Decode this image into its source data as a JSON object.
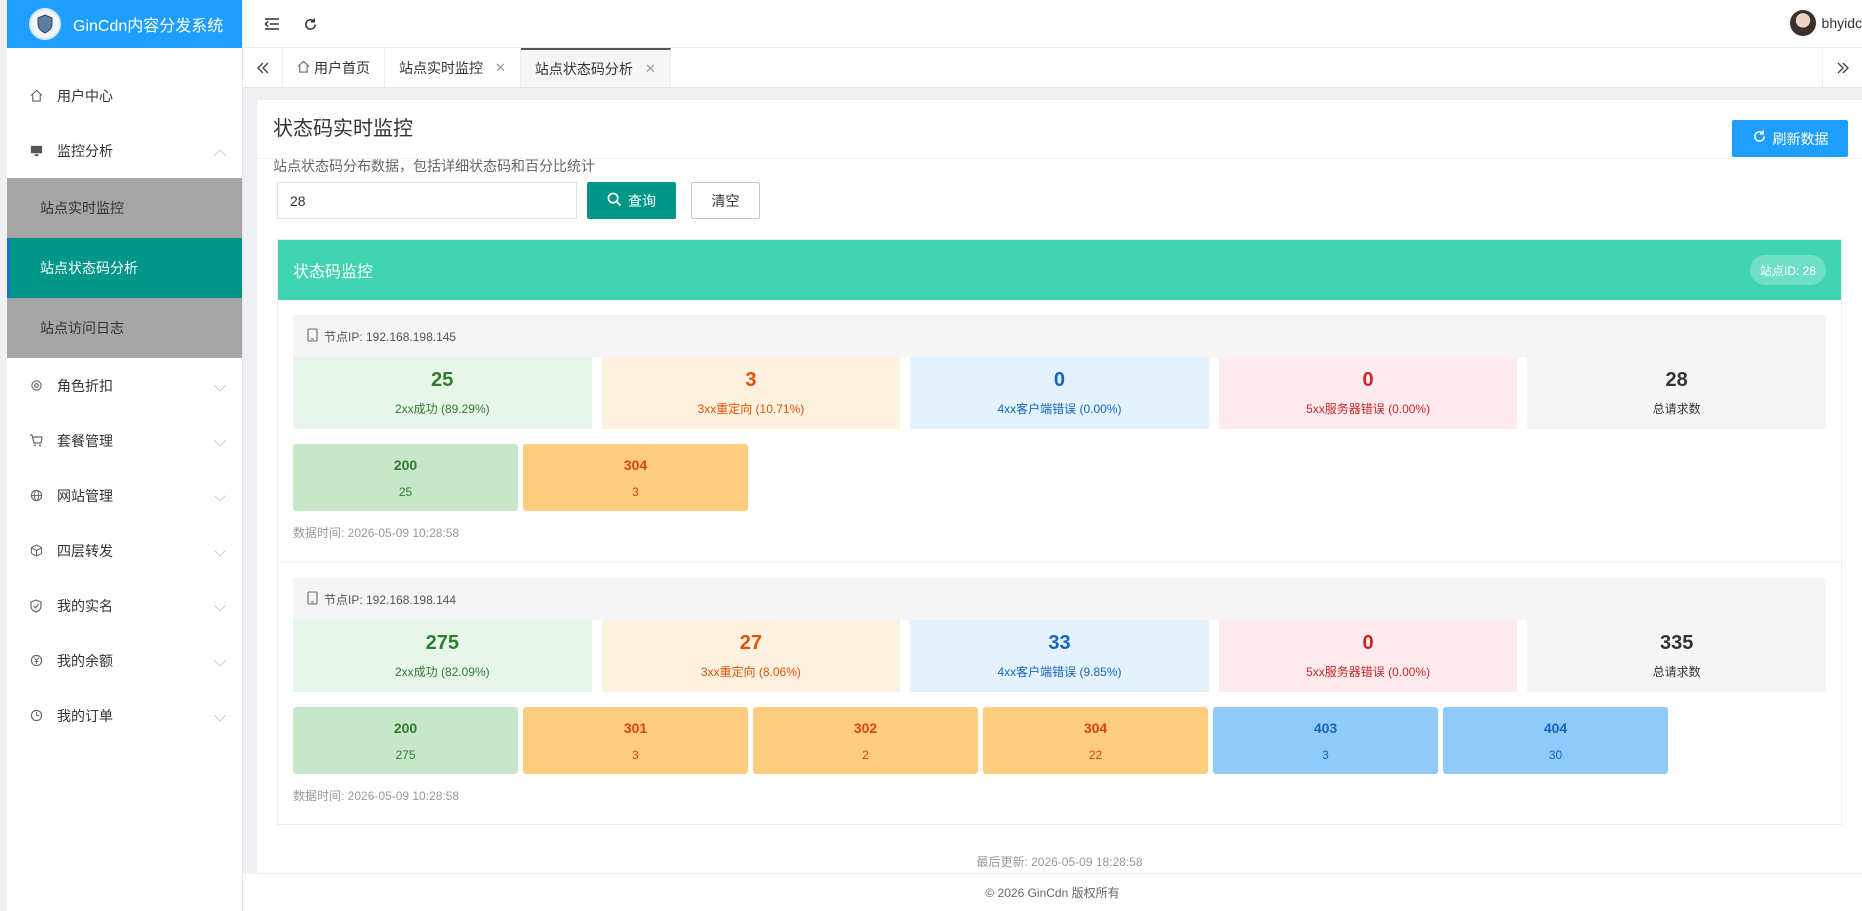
{
  "brand": {
    "title": "GinCdn内容分发系统"
  },
  "sidebar": {
    "items": [
      {
        "label": "用户中心",
        "icon": "home-icon"
      },
      {
        "label": "监控分析",
        "icon": "monitor-icon",
        "expanded": true,
        "children": [
          {
            "label": "站点实时监控",
            "active": false
          },
          {
            "label": "站点状态码分析",
            "active": true
          },
          {
            "label": "站点访问日志",
            "active": false
          }
        ]
      },
      {
        "label": "角色折扣",
        "icon": "settings-icon"
      },
      {
        "label": "套餐管理",
        "icon": "cart-icon"
      },
      {
        "label": "网站管理",
        "icon": "globe-icon"
      },
      {
        "label": "四层转发",
        "icon": "cube-icon"
      },
      {
        "label": "我的实名",
        "icon": "shield-icon"
      },
      {
        "label": "我的余额",
        "icon": "yen-icon"
      },
      {
        "label": "我的订单",
        "icon": "clock-icon"
      }
    ]
  },
  "header": {
    "username": "bhyidc"
  },
  "tabs": [
    {
      "label": "用户首页",
      "closable": false,
      "active": false
    },
    {
      "label": "站点实时监控",
      "closable": true,
      "active": false
    },
    {
      "label": "站点状态码分析",
      "closable": true,
      "active": true
    }
  ],
  "page": {
    "title": "状态码实时监控",
    "subtitle": "站点状态码分布数据，包括详细状态码和百分比统计",
    "refresh_label": "刷新数据",
    "search_value": "28",
    "query_label": "查询",
    "clear_label": "清空"
  },
  "panel": {
    "title": "状态码监控",
    "site_badge": "站点ID: 28",
    "nodes": [
      {
        "ip_label": "节点IP: 192.168.198.145",
        "stats": {
          "s2": {
            "value": "25",
            "label": "2xx成功 (89.29%)"
          },
          "s3": {
            "value": "3",
            "label": "3xx重定向 (10.71%)"
          },
          "s4": {
            "value": "0",
            "label": "4xx客户端错误 (0.00%)"
          },
          "s5": {
            "value": "0",
            "label": "5xx服务器错误 (0.00%)"
          },
          "total": {
            "value": "28",
            "label": "总请求数"
          }
        },
        "codes": [
          {
            "code": "200",
            "count": "25",
            "color": "#c8e6c9"
          },
          {
            "code": "304",
            "count": "3",
            "color": "#ffcc80"
          }
        ],
        "time": "数据时间: 2026-05-09 10:28:58"
      },
      {
        "ip_label": "节点IP: 192.168.198.144",
        "stats": {
          "s2": {
            "value": "275",
            "label": "2xx成功 (82.09%)"
          },
          "s3": {
            "value": "27",
            "label": "3xx重定向 (8.06%)"
          },
          "s4": {
            "value": "33",
            "label": "4xx客户端错误 (9.85%)"
          },
          "s5": {
            "value": "0",
            "label": "5xx服务器错误 (0.00%)"
          },
          "total": {
            "value": "335",
            "label": "总请求数"
          }
        },
        "codes": [
          {
            "code": "200",
            "count": "275",
            "color": "#c8e6c9"
          },
          {
            "code": "301",
            "count": "3",
            "color": "#ffcc80"
          },
          {
            "code": "302",
            "count": "2",
            "color": "#ffcc80"
          },
          {
            "code": "304",
            "count": "22",
            "color": "#ffcc80"
          },
          {
            "code": "403",
            "count": "3",
            "color": "#90caf9"
          },
          {
            "code": "404",
            "count": "30",
            "color": "#90caf9"
          }
        ],
        "time": "数据时间: 2026-05-09 10:28:58"
      }
    ]
  },
  "last_update": "最后更新: 2026-05-09 18:28:58",
  "footer": "© 2026 GinCdn 版权所有",
  "colors": {
    "primary": "#1e9fff",
    "teal": "#009688",
    "panel_head": "#40d3b0"
  }
}
